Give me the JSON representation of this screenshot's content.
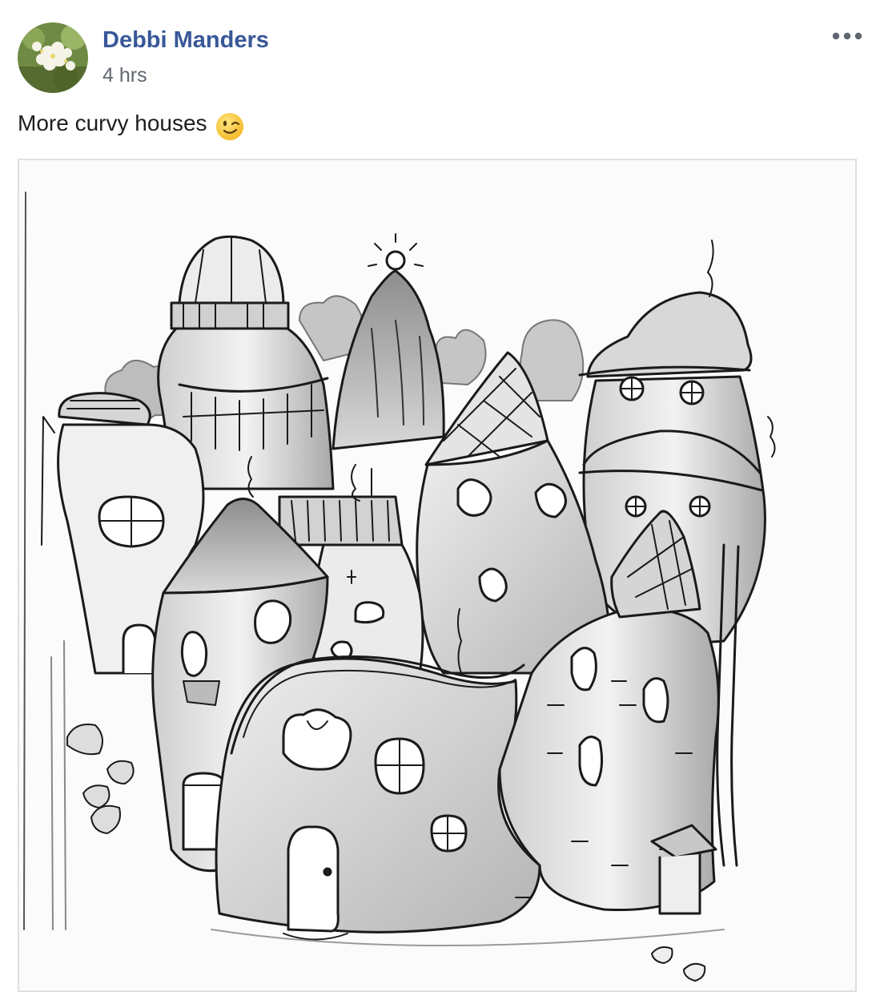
{
  "post": {
    "author_name": "Debbi Manders",
    "timestamp": "4 hrs",
    "text": "More curvy houses",
    "emoji": "winking-face-emoji",
    "avatar": "profile-photo-flowers",
    "menu_icon": "more-options-icon",
    "photo": "pencil-drawing-curvy-houses"
  },
  "colors": {
    "author_link": "#385898",
    "timestamp": "#606770",
    "text": "#1c1e21",
    "photo_border": "#dddfe2"
  }
}
